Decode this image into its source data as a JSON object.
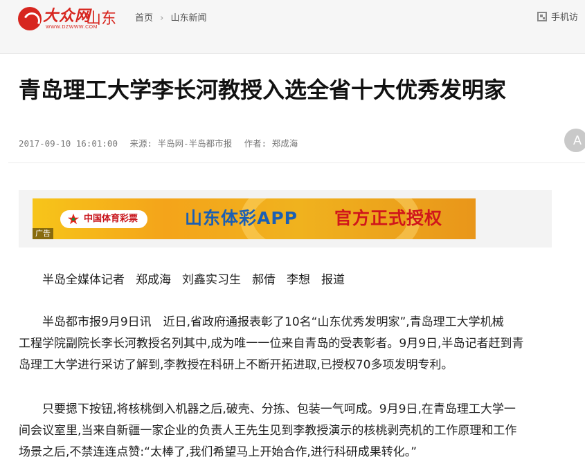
{
  "header": {
    "logo_text": "大众网",
    "logo_url_text": "WWW.DZWWW.COM",
    "region": "山东",
    "breadcrumb": [
      "首页",
      "山东新闻"
    ],
    "mobile_link": "手机访"
  },
  "article": {
    "title": "青岛理工大学李长河教授入选全省十大优秀发明家",
    "datetime": "2017-09-10 16:01:00",
    "source": "来源: 半岛网-半岛都市报",
    "author": "作者: 郑成海",
    "font_button": "A"
  },
  "ad": {
    "lottery_name": "中国体育彩票",
    "app_text": "山东体彩APP",
    "auth_text": "官方正式授权",
    "tag": "广告"
  },
  "paragraphs": {
    "byline": [
      "半岛全媒体记者",
      "郑成海",
      "刘鑫实习生",
      "郝倩",
      "李想",
      "报道"
    ],
    "p2_lines": [
      "半岛都市报9月9日讯　近日,省政府通报表彰了10名“山东优秀发明家”,青岛理工大学机械",
      "工程学院副院长李长河教授名列其中,成为唯一一位来自青岛的受表彰者。9月9日,半岛记者赶到青",
      "岛理工大学进行采访了解到,李教授在科研上不断开拓进取,已授权70多项发明专利。"
    ],
    "p3_lines": [
      "只要摁下按钮,将核桃倒入机器之后,破壳、分拣、包装一气呵成。9月9日,在青岛理工大学一",
      "间会议室里,当来自新疆一家企业的负责人王先生见到李教授演示的核桃剥壳机的工作原理和工作",
      "场景之后,不禁连连点赞:“太棒了,我们希望马上开始合作,进行科研成果转化。”"
    ]
  }
}
